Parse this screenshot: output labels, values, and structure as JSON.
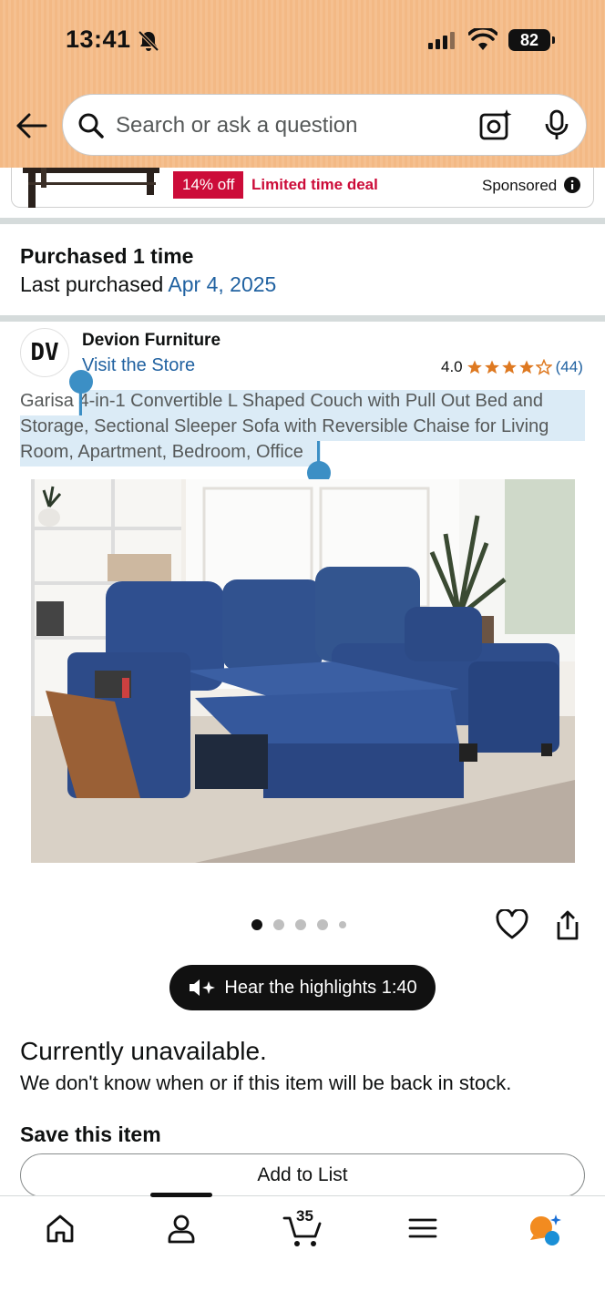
{
  "status_bar": {
    "time": "13:41",
    "battery": "82"
  },
  "search": {
    "placeholder": "Search or ask a question"
  },
  "ad": {
    "discount": "14% off",
    "deal": "Limited time deal",
    "sponsored": "Sponsored"
  },
  "purchase": {
    "title": "Purchased 1 time",
    "last_label": "Last purchased",
    "last_date": "Apr 4, 2025"
  },
  "store": {
    "logo_text": "DV",
    "name": "Devion Furniture",
    "link": "Visit the Store",
    "rating": "4.0",
    "rating_count": "(44)",
    "rating_value": 4.0
  },
  "product": {
    "title": "Garisa 4-in-1 Convertible L Shaped Couch with Pull Out Bed and Storage, Sectional Sleeper Sofa with Reversible Chaise for Living Room, Apartment, Bedroom, Office"
  },
  "carousel": {
    "total_dots": 5,
    "active_index": 0
  },
  "audio": {
    "label": "Hear the highlights 1:40"
  },
  "availability": {
    "title": "Currently unavailable.",
    "message": "We don't know when or if this item will be back in stock."
  },
  "save": {
    "title": "Save this item",
    "button": "Add to List"
  },
  "nav": {
    "cart_count": "35"
  },
  "colors": {
    "accent_link": "#2162a1",
    "deal_red": "#cc0c39",
    "star": "#de7921",
    "header": "#f4bc8a"
  }
}
